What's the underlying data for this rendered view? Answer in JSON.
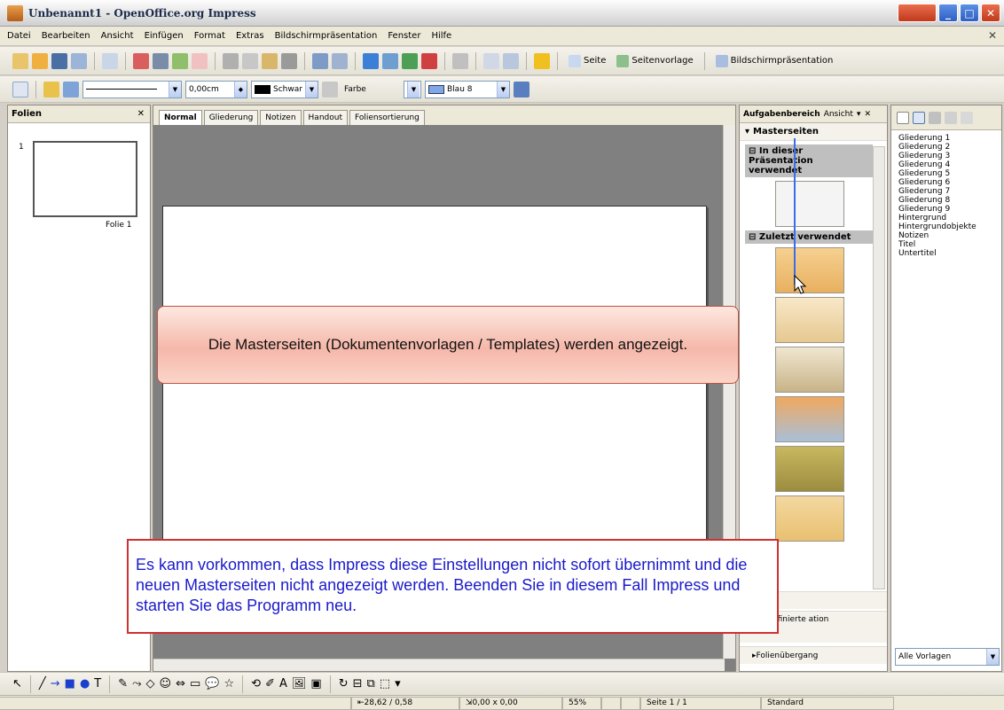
{
  "window": {
    "title": "Unbenannt1 - OpenOffice.org Impress"
  },
  "menu": [
    "Datei",
    "Bearbeiten",
    "Ansicht",
    "Einfügen",
    "Format",
    "Extras",
    "Bildschirmpräsentation",
    "Fenster",
    "Hilfe"
  ],
  "toolbar": {
    "slide_label": "Seite",
    "layout_label": "Seitenvorlage",
    "presentation_label": "Bildschirmpräsentation"
  },
  "linebar": {
    "line_width": "0,00cm",
    "line_color": "Schwar",
    "fill_type": "Farbe",
    "fill_color": "Blau 8"
  },
  "slides_panel": {
    "title": "Folien",
    "slide_number": "1",
    "slide_label": "Folie 1"
  },
  "tabs": [
    "Normal",
    "Gliederung",
    "Notizen",
    "Handout",
    "Foliensortierung"
  ],
  "task_pane": {
    "title": "Aufgabenbereich",
    "view_label": "Ansicht",
    "section": "Masterseiten",
    "used_label": "In dieser Präsentation verwendet",
    "recent_label": "Zuletzt verwendet",
    "layouts_label": "uts",
    "custom_anim_label": "tzerdefinierte ation",
    "transition_label": "Folienübergang"
  },
  "styles": {
    "items": [
      "Gliederung 1",
      "Gliederung 2",
      "Gliederung 3",
      "Gliederung 4",
      "Gliederung 5",
      "Gliederung 6",
      "Gliederung 7",
      "Gliederung 8",
      "Gliederung 9",
      "Hintergrund",
      "Hintergrundobjekte",
      "Notizen",
      "Titel",
      "Untertitel"
    ],
    "filter": "Alle Vorlagen"
  },
  "statusbar": {
    "position": "28,62 / 0,58",
    "size": "0,00 x 0,00",
    "zoom": "55%",
    "page": "Seite 1 / 1",
    "layout": "Standard"
  },
  "callouts": {
    "primary": "Die Masterseiten (Dokumentenvorlagen / Templates) werden angezeigt.",
    "secondary": "Es kann vorkommen, dass Impress diese Einstellungen nicht sofort übernimmt und die neuen Masterseiten nicht angezeigt werden. Beenden Sie in diesem Fall Impress und starten Sie das Programm neu."
  },
  "colors": {
    "callout_text": "#1a1acc",
    "callout_border": "#d03030",
    "arrow": "#3a6ee8"
  }
}
